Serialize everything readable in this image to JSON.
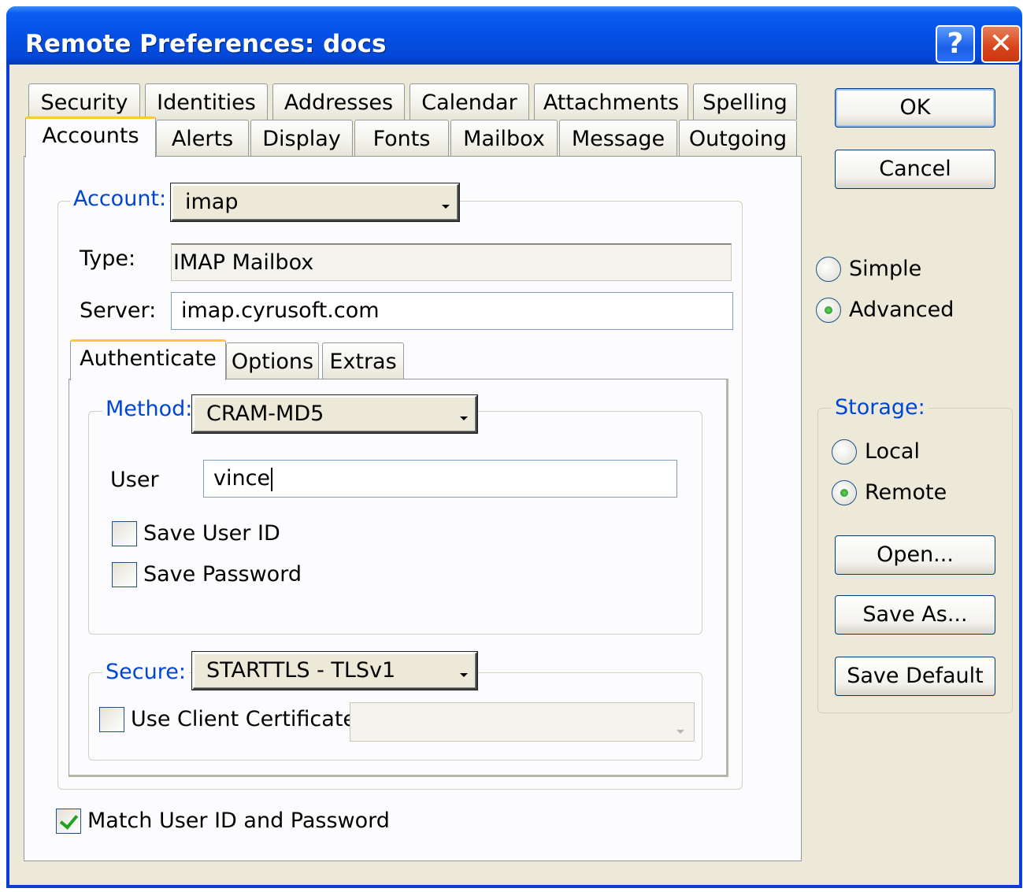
{
  "window": {
    "title": "Remote Preferences:  docs",
    "help_glyph": "?",
    "close_glyph": "✕"
  },
  "tabs_row1": [
    "Security",
    "Identities",
    "Addresses",
    "Calendar",
    "Attachments",
    "Spelling"
  ],
  "tabs_row2": [
    "Accounts",
    "Alerts",
    "Display",
    "Fonts",
    "Mailbox",
    "Message",
    "Outgoing"
  ],
  "active_tab": "Accounts",
  "account": {
    "label": "Account:",
    "value": "imap",
    "type_label": "Type:",
    "type_value": "IMAP Mailbox",
    "server_label": "Server:",
    "server_value": "imap.cyrusoft.com"
  },
  "subtabs": [
    "Authenticate",
    "Options",
    "Extras"
  ],
  "active_subtab": "Authenticate",
  "auth": {
    "method_label": "Method:",
    "method_value": "CRAM-MD5",
    "user_label": "User",
    "user_value": "vince",
    "save_user_id": {
      "label": "Save User ID",
      "checked": false
    },
    "save_password": {
      "label": "Save Password",
      "checked": false
    }
  },
  "secure": {
    "label": "Secure:",
    "value": "STARTTLS - TLSv1",
    "use_client_cert": {
      "label": "Use Client Certificate:",
      "checked": false
    },
    "cert_value": ""
  },
  "match_user": {
    "label": "Match User ID and Password",
    "checked": true
  },
  "buttons": {
    "ok": "OK",
    "cancel": "Cancel",
    "open": "Open...",
    "save_as": "Save As...",
    "save_default": "Save Default"
  },
  "mode": {
    "simple": "Simple",
    "advanced": "Advanced",
    "selected": "Advanced"
  },
  "storage": {
    "label": "Storage:",
    "local": "Local",
    "remote": "Remote",
    "selected": "Remote"
  },
  "colors": {
    "titlebar": "#0550e4",
    "group_label": "#0046d5",
    "dialog_bg": "#ece9d8",
    "tab_highlight": "#ffc83c",
    "check_mark": "#21a121"
  }
}
